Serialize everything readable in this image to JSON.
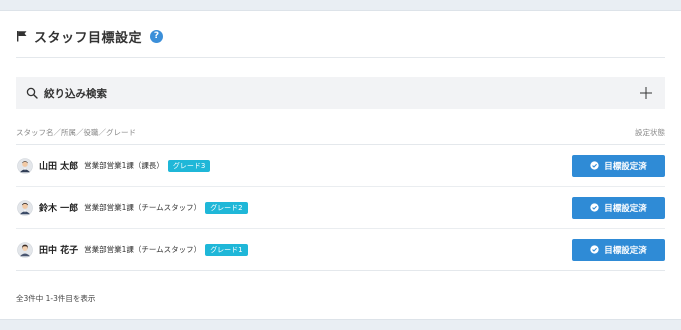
{
  "header": {
    "title": "スタッフ目標設定",
    "help_label": "?"
  },
  "search": {
    "label": "絞り込み検索"
  },
  "list": {
    "column_left": "スタッフ名／所属／役職／グレード",
    "column_right": "設定状態",
    "rows": [
      {
        "name": "山田 太郎",
        "dept": "営業部営業1課（課長）",
        "grade": "グレード3",
        "status": "目標設定済"
      },
      {
        "name": "鈴木 一郎",
        "dept": "営業部営業1課（チームスタッフ）",
        "grade": "グレード2",
        "status": "目標設定済"
      },
      {
        "name": "田中 花子",
        "dept": "営業部営業1課（チームスタッフ）",
        "grade": "グレード1",
        "status": "目標設定済"
      }
    ]
  },
  "footer": {
    "summary": "全3件中 1-3件目を表示"
  },
  "colors": {
    "accent": "#2f8bd6",
    "grade_badge": "#1fb7d8",
    "help_badge": "#3b8fd9"
  }
}
